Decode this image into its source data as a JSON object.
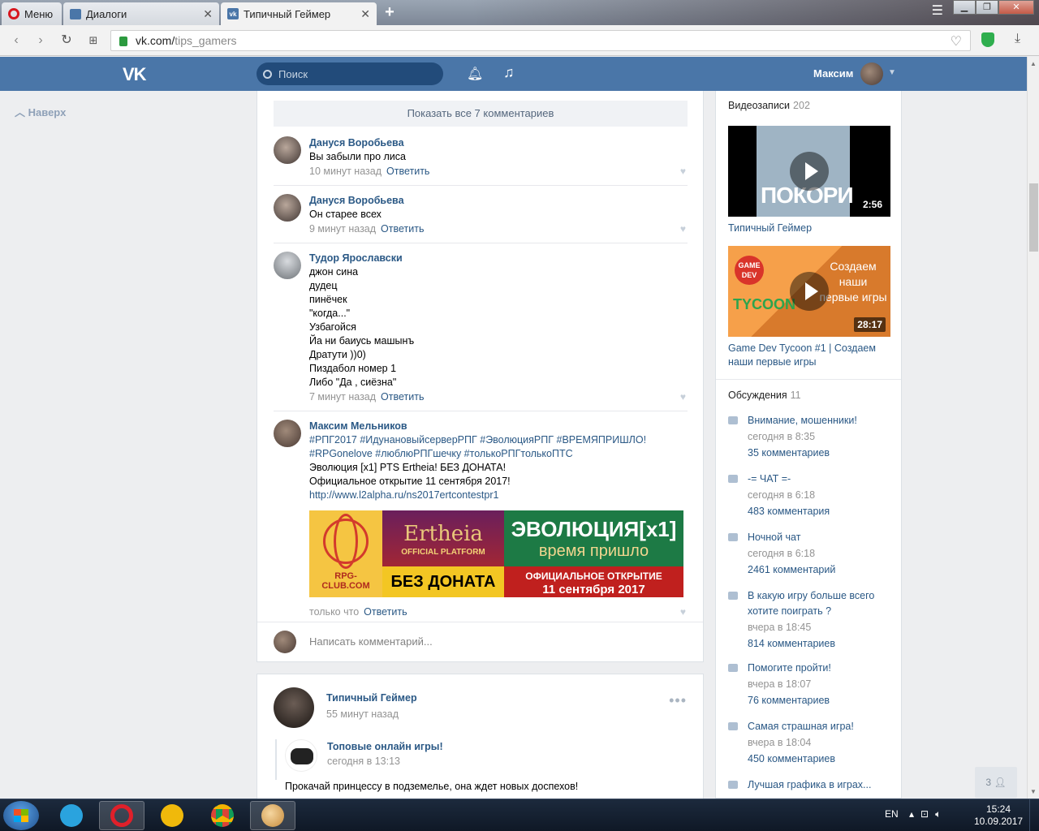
{
  "browser": {
    "tabs": [
      {
        "label": "Меню",
        "icon": "opera-icon"
      },
      {
        "label": "Диалоги",
        "icon": "chat-icon"
      },
      {
        "label": "Типичный Геймер",
        "icon": "vk-icon"
      }
    ],
    "url_host": "vk.com/",
    "url_path": "tips_gamers"
  },
  "header": {
    "logo": "VK",
    "search_placeholder": "Поиск",
    "user_name": "Максим"
  },
  "left_nav": {
    "back_to_top": "Наверх"
  },
  "comments_block": {
    "show_all": "Показать все 7 комментариев",
    "reply_label": "Ответить",
    "comments": [
      {
        "author": "Дануся Воробьева",
        "lines": [
          "Вы забыли про лиса"
        ],
        "time": "10 минут назад"
      },
      {
        "author": "Дануся Воробьева",
        "lines": [
          "Он старее всех"
        ],
        "time": "9 минут назад"
      },
      {
        "author": "Тудор Ярославски",
        "lines": [
          "джон сина",
          "дудец",
          "пинёчек",
          "\"когда...\"",
          "Узбагойся",
          "Йа ни баиусь машынъ",
          "Дратути ))0)",
          "Пиздабол номер 1",
          "Либо \"Да , сиёзна\""
        ],
        "time": "7 минут назад"
      },
      {
        "author": "Максим Мельников",
        "hashtags_1": "#РПГ2017 #ИдунановыйсерверРПГ #ЭволюцияРПГ #ВРЕМЯПРИШЛО!",
        "hashtags_2": "#RPGonelove #люблюРПГшечку #толькоРПГтолькоПТС",
        "lines": [
          "Эволюция [x1] PTS Ertheia! БЕЗ ДОНАТА!",
          "Официальное открытие 11 сентября 2017!"
        ],
        "link": "http://www.l2alpha.ru/ns2017ertcontestpr1",
        "time": "только что"
      }
    ],
    "banner": {
      "panel1_caption": "RPG-CLUB.COM",
      "panel2_title": "Ertheia",
      "panel2_sub": "OFFICIAL PLATFORM",
      "panel2_bottom": "БЕЗ ДОНАТА",
      "panel3_title": "ЭВОЛЮЦИЯ[x1]",
      "panel3_sub": "время пришло",
      "panel3_bottom_1": "ОФИЦИАЛЬНОЕ ОТКРЫТИЕ",
      "panel3_bottom_2": "11 сентября 2017"
    },
    "write_placeholder": "Написать комментарий..."
  },
  "next_post": {
    "author": "Типичный Геймер",
    "time": "55 минут назад",
    "repost_author": "Топовые онлайн игры!",
    "repost_time": "сегодня в 13:13",
    "text": "Прокачай принцессу в подземелье, она ждет новых доспехов!"
  },
  "sidebar": {
    "videos_title": "Видеозаписи",
    "videos_count": "202",
    "videos": [
      {
        "overlay": "ПОКОРИ",
        "duration": "2:56",
        "caption": "Типичный Геймер"
      },
      {
        "logo": "GAME DEV",
        "logo_word": "TYCOON",
        "overlay": "Создаем наши первые игры",
        "duration": "28:17",
        "caption": "Game Dev Tycoon #1 | Создаем наши первые игры"
      }
    ],
    "discussions_title": "Обсуждения",
    "discussions_count": "11",
    "discussions": [
      {
        "title": "Внимание, мошенники!",
        "time": "сегодня в 8:35",
        "count": "35 комментариев"
      },
      {
        "title": "-= ЧАТ =-",
        "time": "сегодня в 6:18",
        "count": "483 комментария"
      },
      {
        "title": "Ночной чат",
        "time": "сегодня в 6:18",
        "count": "2461 комментарий"
      },
      {
        "title": "В какую игру больше всего хотите поиграть ?",
        "time": "вчера в 18:45",
        "count": "814 комментариев"
      },
      {
        "title": "Помогите пройти!",
        "time": "вчера в 18:07",
        "count": "76 комментариев"
      },
      {
        "title": "Самая страшная игра!",
        "time": "вчера в 18:04",
        "count": "450 комментариев"
      },
      {
        "title": "Лучшая графика в играх...",
        "time": "",
        "count": ""
      }
    ],
    "friends_online": "3"
  },
  "taskbar": {
    "lang": "EN",
    "time": "15:24",
    "date": "10.09.2017"
  }
}
